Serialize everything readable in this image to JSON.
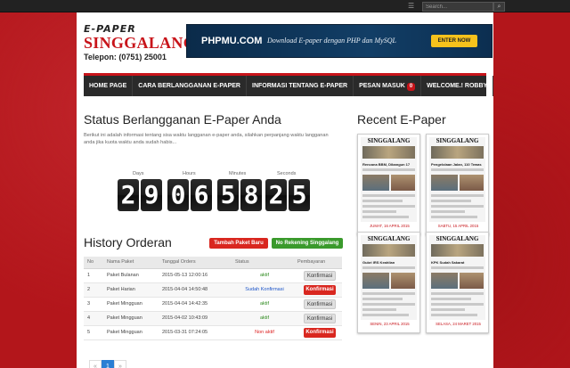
{
  "topbar": {
    "search_placeholder": "Search...",
    "search_icon": "magnifier-icon",
    "rss_icon": "rss-icon"
  },
  "logo": {
    "line1": "E-PAPER",
    "line2": "SINGGALANG",
    "line3": "Telepon: (0751) 25001"
  },
  "banner": {
    "title": "PHPMU.COM",
    "subtitle": "Download E-paper dengan PHP dan MySQL",
    "button": "ENTER NOW"
  },
  "nav": {
    "items": [
      "HOME PAGE",
      "CARA BERLANGGANAN E-PAPER",
      "INFORMASI TENTANG E-PAPER",
      "PESAN MASUK",
      "WELCOME.! ROBBY"
    ],
    "inbox_count": "0"
  },
  "status": {
    "heading": "Status Berlangganan E-Paper Anda",
    "description": "Berikut ini adalah informasi tentang sisa waktu langganan e-paper anda, silahkan perpanjang waktu langganan anda jika kuota waktu anda sudah habis...",
    "labels": [
      "Days",
      "Hours",
      "Minutes",
      "Seconds"
    ],
    "digits": [
      "2",
      "9",
      "0",
      "6",
      "5",
      "8",
      "2",
      "5"
    ]
  },
  "history": {
    "heading": "History Orderan",
    "btn_new": "Tambah Paket Baru",
    "btn_rekening": "No Rekening Singgalang",
    "columns": [
      "No",
      "Nama Paket",
      "Tanggal Orders",
      "Status",
      "Pembayaran"
    ],
    "rows": [
      {
        "no": "1",
        "paket": "Paket Bulanan",
        "tanggal": "2015-05-13 12:00:16",
        "status": "aktif",
        "status_class": "st-green",
        "bayar": "Konfirmasi",
        "bayar_class": "gray"
      },
      {
        "no": "2",
        "paket": "Paket Harian",
        "tanggal": "2015-04-04 14:50:48",
        "status": "Sudah Konfirmasi",
        "status_class": "st-blue",
        "bayar": "Konfirmasi",
        "bayar_class": "red"
      },
      {
        "no": "3",
        "paket": "Paket Mingguan",
        "tanggal": "2015-04-04 14:42:35",
        "status": "aktif",
        "status_class": "st-green",
        "bayar": "Konfirmasi",
        "bayar_class": "gray"
      },
      {
        "no": "4",
        "paket": "Paket Mingguan",
        "tanggal": "2015-04-02 10:43:09",
        "status": "aktif",
        "status_class": "st-green",
        "bayar": "Konfirmasi",
        "bayar_class": "gray"
      },
      {
        "no": "5",
        "paket": "Paket Mingguan",
        "tanggal": "2015-03-31 07:24:05",
        "status": "Non aktif",
        "status_class": "st-red",
        "bayar": "Konfirmasi",
        "bayar_class": "red"
      }
    ],
    "pager": [
      "«",
      "1",
      "»"
    ]
  },
  "recent": {
    "heading": "Recent E-Paper",
    "items": [
      {
        "masthead": "SINGGALANG",
        "headline": "Rencana BBM, Dibangun 17",
        "caption": "JUMAT, 16 APRIL 2015"
      },
      {
        "masthead": "SINGGALANG",
        "headline": "Pengelolaan Jalan, 110 Tewas",
        "caption": "SABTU, 15 APRIL 2015"
      },
      {
        "masthead": "SINGGALANG",
        "headline": "Gubri IRS Keahlian",
        "caption": "SENIN, 23 APRIL 2015"
      },
      {
        "masthead": "SINGGALANG",
        "headline": "KPK Sudah Sakarat",
        "caption": "SELASA, 24 MARET 2015"
      }
    ]
  },
  "colors": {
    "accent": "#c8141a",
    "nav_bg": "#2a2a2a",
    "green": "#3a9a2c",
    "blue": "#2a7fd4"
  }
}
